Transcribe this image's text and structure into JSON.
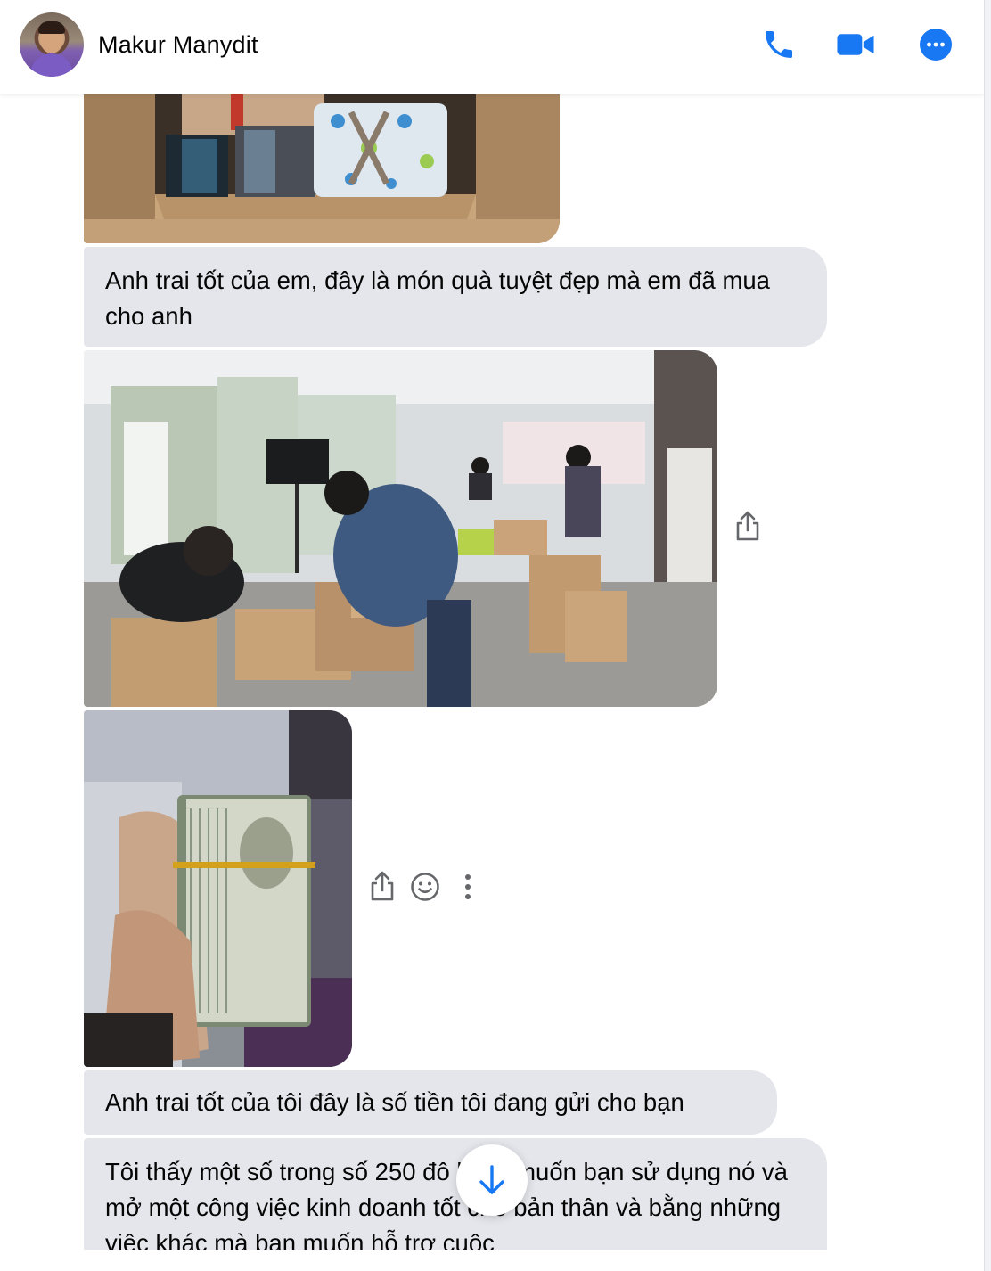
{
  "header": {
    "contact_name": "Makur Manydit",
    "icons": [
      "phone-icon",
      "video-camera-icon",
      "more-options-icon"
    ],
    "accent_color": "#1877f2"
  },
  "messages": [
    {
      "type": "image",
      "content": "photo-gift-boxes"
    },
    {
      "type": "text",
      "text": "Anh trai tốt của em, đây là món quà tuyệt đẹp mà em đã mua cho anh"
    },
    {
      "type": "image",
      "content": "photo-office-packing"
    },
    {
      "type": "image",
      "content": "photo-dollar-stack"
    },
    {
      "type": "text",
      "text": "Anh trai tốt của tôi đây là số tiền tôi đang gửi cho bạn"
    },
    {
      "type": "text",
      "text": "Tôi thấy một số trong số 250 đô la tôi muốn bạn sử dụng nó và mở một công việc kinh doanh tốt cho bản thân và bằng những việc khác mà bạn muốn hỗ trợ cuộc"
    }
  ],
  "message_actions": [
    "share-icon",
    "smiley-react-icon",
    "more-vertical-icon"
  ],
  "bubble_color": "#e4e6eb"
}
